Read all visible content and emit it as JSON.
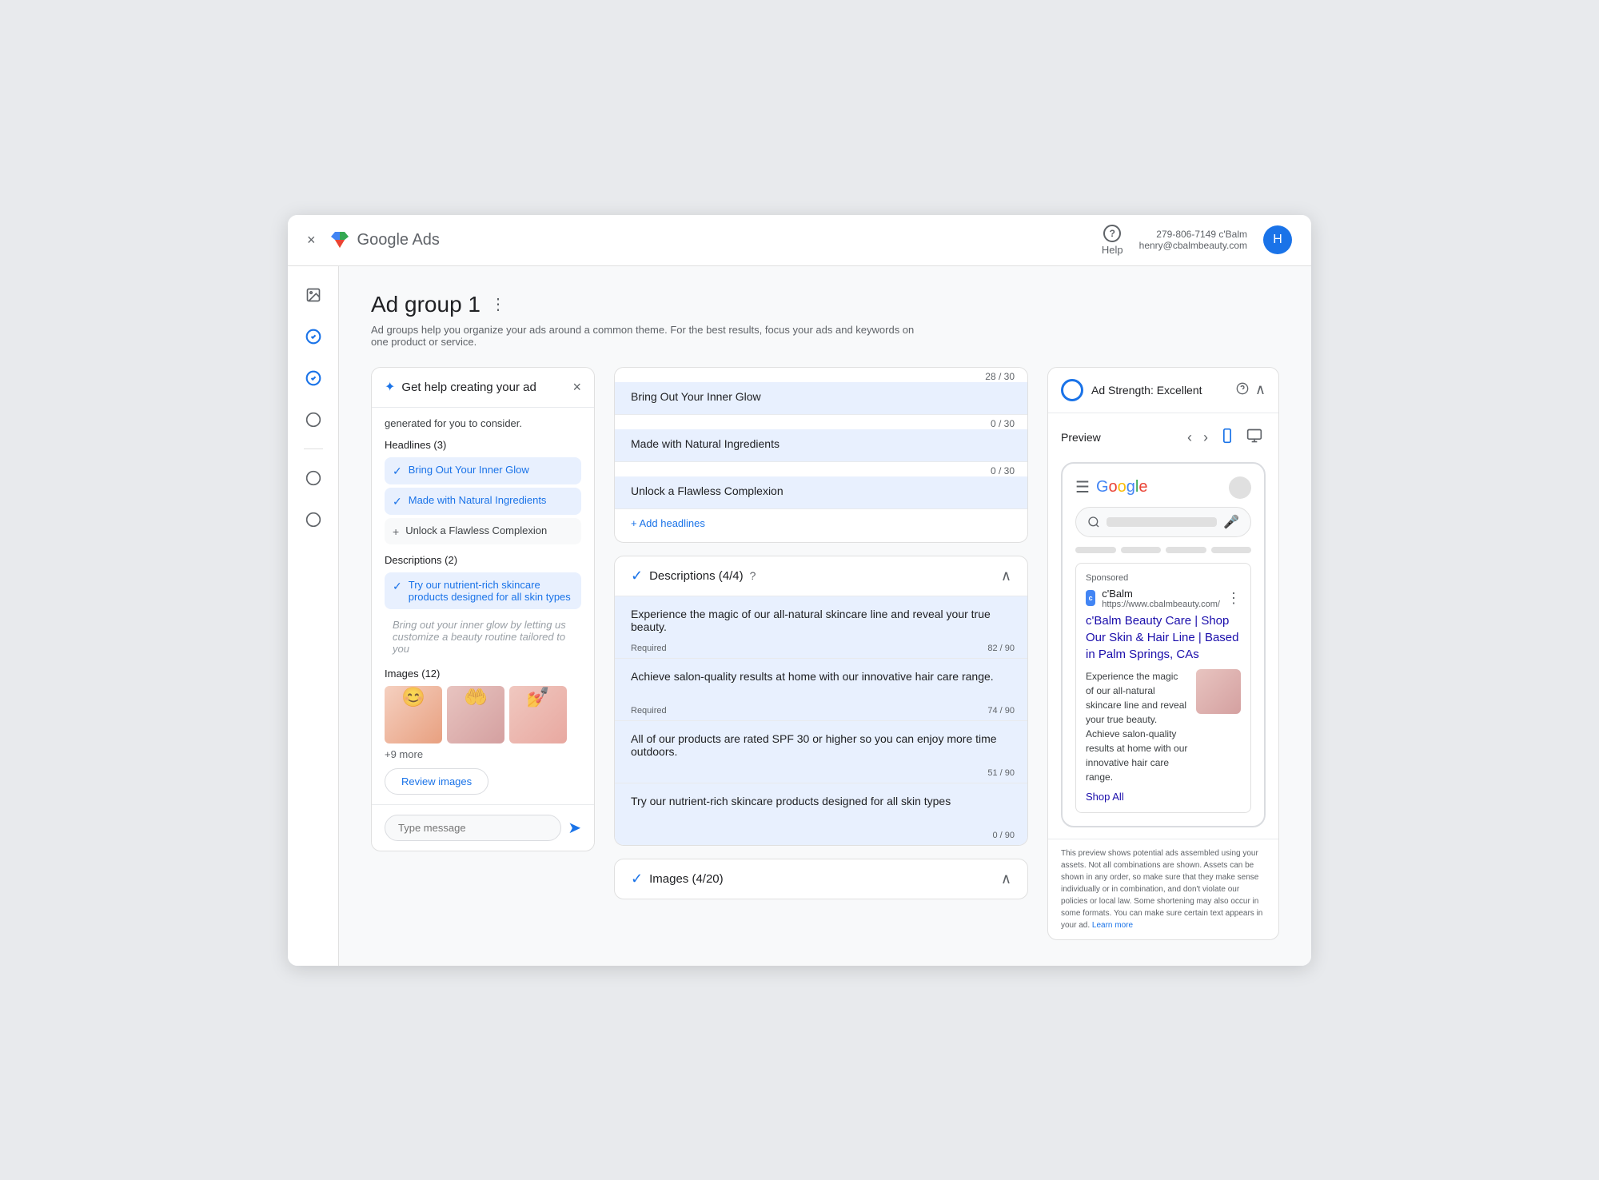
{
  "window": {
    "close_icon": "×",
    "brand": "Google Ads"
  },
  "topbar": {
    "help_label": "Help",
    "help_icon": "?",
    "account_phone": "279-806-7149 c'Balm",
    "account_email": "henry@cbalmbeauty.com",
    "avatar_initial": "H"
  },
  "sidebar": {
    "icons": [
      "🖼",
      "✓",
      "✓",
      "○",
      "○",
      "○"
    ]
  },
  "page": {
    "title": "Ad group 1",
    "more_icon": "⋮",
    "subtitle": "Ad groups help you organize your ads around a common theme. For the best results, focus your ads and keywords on one product or service."
  },
  "chat_panel": {
    "spark_icon": "✦",
    "title": "Get help creating your ad",
    "close_icon": "×",
    "generated_text": "generated for you to consider.",
    "headlines_label": "Headlines (3)",
    "headlines": [
      {
        "text": "Bring Out Your Inner Glow",
        "checked": true
      },
      {
        "text": "Made with Natural Ingredients",
        "checked": true
      },
      {
        "text": "Unlock a Flawless Complexion",
        "checked": false
      }
    ],
    "descriptions_label": "Descriptions (2)",
    "descriptions": [
      {
        "text": "Try our nutrient-rich skincare products designed for all skin types",
        "checked": true
      },
      {
        "text": "Bring out your inner glow by letting us customize a beauty routine tailored to you",
        "checked": false,
        "grayed": true
      }
    ],
    "images_label": "Images (12)",
    "more_count": "+9 more",
    "review_btn": "Review images",
    "input_placeholder": "Type message",
    "send_icon": "➤"
  },
  "headlines_section": {
    "title": "Headlines (3)",
    "checkmark": "✓",
    "fields": [
      {
        "value": "Bring Out Your Inner Glow",
        "counter": "28 / 30"
      },
      {
        "value": "Made with Natural Ingredients",
        "counter": "0 / 30"
      },
      {
        "value": "Unlock a Flawless Complexion",
        "counter": "0 / 30"
      }
    ],
    "add_label": "+ Add headlines"
  },
  "descriptions_section": {
    "title": "Descriptions (4/4)",
    "checkmark": "✓",
    "fields": [
      {
        "value": "Experience the magic of our all-natural skincare line and reveal your true beauty.",
        "required": "Required",
        "counter": "82 / 90"
      },
      {
        "value": "Achieve salon-quality results at home with our innovative hair care range.",
        "required": "Required",
        "counter": "74 / 90"
      },
      {
        "value": "All of our products are rated SPF 30 or higher so you can enjoy more time outdoors.",
        "required": "",
        "counter": "51 / 90"
      },
      {
        "value": "Try our nutrient-rich skincare products designed for all skin types",
        "required": "",
        "counter": "0 / 90"
      }
    ]
  },
  "images_section": {
    "title": "Images (4/20)",
    "checkmark": "✓"
  },
  "ad_strength": {
    "title": "Ad Strength: Excellent",
    "help_icon": "?",
    "preview_label": "Preview",
    "ad": {
      "sponsored_label": "Sponsored",
      "brand_initial": "c",
      "brand_name": "c'Balm",
      "brand_url": "https://www.cbalmbeauty.com/",
      "ad_title": "c'Balm Beauty Care | Shop Our Skin & Hair Line | Based in Palm Springs, CAs",
      "ad_body1": "Experience the magic of our all-natural skincare line and reveal your true beauty. Achieve salon-quality results at home with our innovative hair care range.",
      "shop_label": "Shop All"
    },
    "disclaimer": "This preview shows potential ads assembled using your assets. Not all combinations are shown. Assets can be shown in any order, so make sure that they make sense individually or in combination, and don't violate our policies or local law. Some shortening may also occur in some formats. You can make sure certain text appears in your ad.",
    "learn_more": "Learn more"
  }
}
